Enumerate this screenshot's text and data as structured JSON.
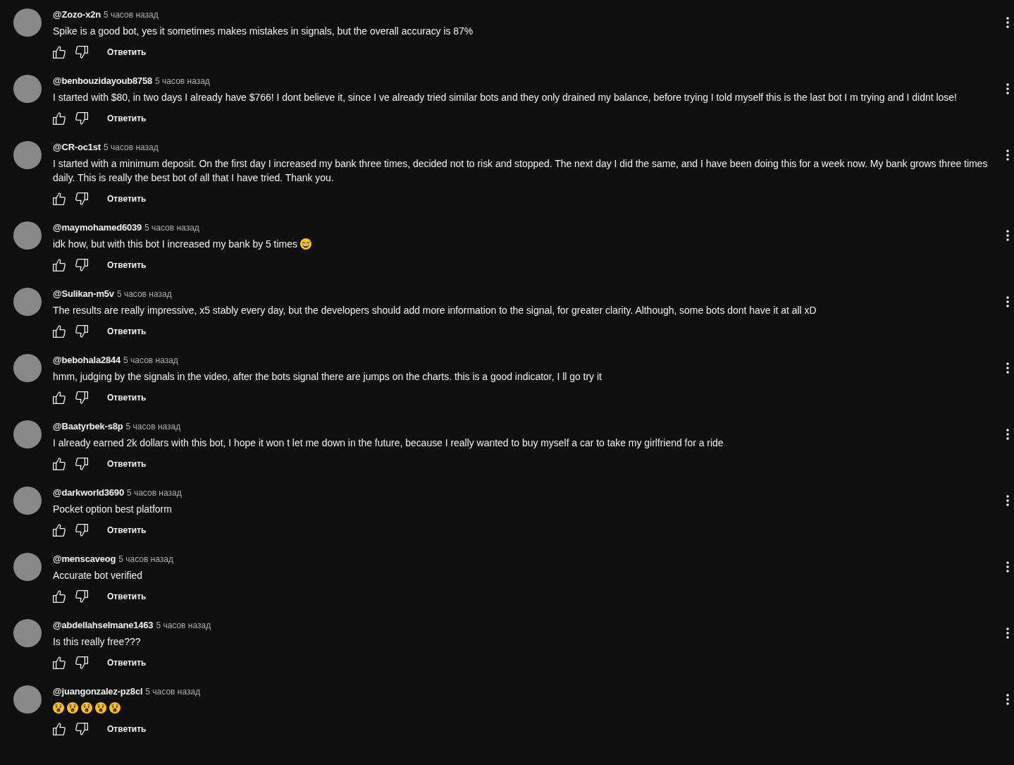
{
  "comments": [
    {
      "author": "@Zozo-x2n",
      "time": "5 часов назад",
      "text": "Spike is a good bot, yes it sometimes makes mistakes in signals, but the overall accuracy is 87%",
      "reply": "Ответить"
    },
    {
      "author": "@benbouzidayoub8758",
      "time": "5 часов назад",
      "text": "I started with $80, in two days I already have $766! I dont believe it, since I ve already tried similar bots and they only drained my balance, before trying I told myself this is the last bot I m trying and I didnt lose!",
      "reply": "Ответить"
    },
    {
      "author": "@CR-oc1st",
      "time": "5 часов назад",
      "text": "I started with a minimum deposit. On the first day I increased my bank three times, decided not to risk and stopped. The next day I did the same, and I have been doing this for a week now. My bank grows three times daily. This is really the best bot of all that I have tried. Thank you.",
      "reply": "Ответить"
    },
    {
      "author": "@maymohamed6039",
      "time": "5 часов назад",
      "text": "idk how, but with this bot I increased my bank by 5 times",
      "emojis": [
        {
          "kind": "sweat-smile"
        }
      ],
      "reply": "Ответить"
    },
    {
      "author": "@Sulikan-m5v",
      "time": "5 часов назад",
      "text": "The results are really impressive, x5 stably every day, but the developers should add more information to the signal, for greater clarity. Although, some bots dont have it at all xD",
      "reply": "Ответить"
    },
    {
      "author": "@bebohala2844",
      "time": "5 часов назад",
      "text": "hmm, judging by the signals in the video, after the bots signal there are jumps on the charts. this is a good indicator, I ll go try it",
      "reply": "Ответить"
    },
    {
      "author": "@Baatyrbek-s8p",
      "time": "5 часов назад",
      "text": "I already earned 2k dollars with this bot, I hope it won t let me down in the future, because I really wanted to buy myself a car to take my girlfriend for a ride",
      "reply": "Ответить"
    },
    {
      "author": "@darkworld3690",
      "time": "5 часов назад",
      "text": "Pocket option best platform",
      "reply": "Ответить"
    },
    {
      "author": "@menscaveog",
      "time": "5 часов назад",
      "text": "Accurate bot verified",
      "reply": "Ответить"
    },
    {
      "author": "@abdellahselmane1463",
      "time": "5 часов назад",
      "text": "Is this really free???",
      "reply": "Ответить"
    },
    {
      "author": "@juangonzalez-pz8cl",
      "time": "5 часов назад",
      "emojis": [
        {
          "kind": "open-mouth"
        },
        {
          "kind": "open-mouth"
        },
        {
          "kind": "open-mouth"
        },
        {
          "kind": "open-mouth"
        },
        {
          "kind": "open-mouth"
        }
      ],
      "reply": "Ответить"
    }
  ]
}
